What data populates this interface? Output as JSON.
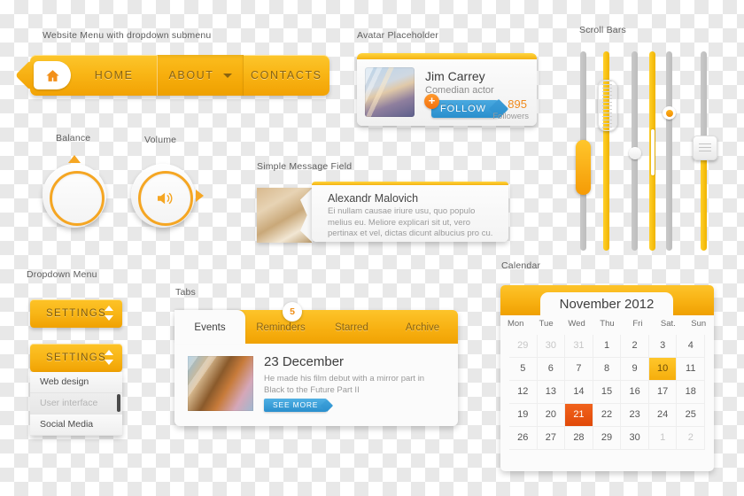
{
  "sections": {
    "menu_label": "Website Menu with dropdown submenu",
    "avatar_label": "Avatar Placeholder",
    "scrollbars_label": "Scroll Bars",
    "balance_label": "Balance",
    "volume_label": "Volume",
    "message_label": "Simple Message Field",
    "dropdown_label": "Dropdown Menu",
    "tabs_label": "Tabs",
    "calendar_label": "Calendar"
  },
  "menu": {
    "home_icon": "home-icon",
    "items": [
      {
        "label": "HOME",
        "active": false
      },
      {
        "label": "ABOUT",
        "active": true,
        "caret": "chevron-down-icon"
      },
      {
        "label": "CONTACTS",
        "active": false
      }
    ]
  },
  "avatar": {
    "name": "Jim Carrey",
    "role": "Comedian actor",
    "follow_label": "FOLLOW",
    "plus_icon": "+",
    "followers_count": "895",
    "followers_label": "Followers"
  },
  "knobs": {
    "balance": {
      "title": "Balance",
      "marker": "up"
    },
    "volume": {
      "title": "Volume",
      "marker": "right",
      "icon": "speaker-icon"
    }
  },
  "message": {
    "name": "Alexandr Malovich",
    "body": "Ei nullam causae iriure usu, quo populo melius eu. Meliore explicari sit ut, vero pertinax et vel, dictas dicunt albucius pro cu."
  },
  "dropdown": {
    "button_label": "SETTINGS",
    "open_button_label": "SETTINGS",
    "items": [
      {
        "label": "Web design",
        "disabled": false
      },
      {
        "label": "User interface",
        "disabled": true
      },
      {
        "label": "Social Media",
        "disabled": false
      }
    ]
  },
  "tabs": {
    "badge": "5",
    "items": [
      {
        "label": "Events",
        "active": true
      },
      {
        "label": "Reminders",
        "active": false
      },
      {
        "label": "Starred",
        "active": false
      },
      {
        "label": "Archive",
        "active": false
      }
    ],
    "event": {
      "title": "23 December",
      "description": "He made his film debut with a mirror part in Black to the Future Part II",
      "button_label": "SEE MORE"
    }
  },
  "calendar": {
    "title": "November 2012",
    "dow": [
      "Mon",
      "Tue",
      "Wed",
      "Thu",
      "Fri",
      "Sat.",
      "Sun"
    ],
    "weeks": [
      [
        {
          "d": "29",
          "s": "mute"
        },
        {
          "d": "30",
          "s": "mute"
        },
        {
          "d": "31",
          "s": "mute"
        },
        {
          "d": "1",
          "s": ""
        },
        {
          "d": "2",
          "s": ""
        },
        {
          "d": "3",
          "s": ""
        },
        {
          "d": "4",
          "s": ""
        }
      ],
      [
        {
          "d": "5",
          "s": ""
        },
        {
          "d": "6",
          "s": ""
        },
        {
          "d": "7",
          "s": ""
        },
        {
          "d": "8",
          "s": ""
        },
        {
          "d": "9",
          "s": ""
        },
        {
          "d": "10",
          "s": "sel-y"
        },
        {
          "d": "11",
          "s": ""
        }
      ],
      [
        {
          "d": "12",
          "s": ""
        },
        {
          "d": "13",
          "s": ""
        },
        {
          "d": "14",
          "s": ""
        },
        {
          "d": "15",
          "s": ""
        },
        {
          "d": "16",
          "s": ""
        },
        {
          "d": "17",
          "s": ""
        },
        {
          "d": "18",
          "s": ""
        }
      ],
      [
        {
          "d": "19",
          "s": ""
        },
        {
          "d": "20",
          "s": ""
        },
        {
          "d": "21",
          "s": "sel-o"
        },
        {
          "d": "22",
          "s": ""
        },
        {
          "d": "23",
          "s": ""
        },
        {
          "d": "24",
          "s": ""
        },
        {
          "d": "25",
          "s": ""
        }
      ],
      [
        {
          "d": "26",
          "s": ""
        },
        {
          "d": "27",
          "s": ""
        },
        {
          "d": "28",
          "s": ""
        },
        {
          "d": "29",
          "s": ""
        },
        {
          "d": "30",
          "s": ""
        },
        {
          "d": "1",
          "s": "mute"
        },
        {
          "d": "2",
          "s": "mute"
        }
      ]
    ]
  },
  "scrollbars": [
    {
      "track": "gray",
      "thumb": "orange-pill"
    },
    {
      "track": "yellow",
      "thumb": "white-ridged-pill"
    },
    {
      "track": "gray",
      "thumb": "white-dot"
    },
    {
      "track": "yellow",
      "thumb": "white-notch"
    },
    {
      "track": "gray",
      "thumb": "orange-dot"
    },
    {
      "track": "split",
      "thumb": "white-ridged-square"
    }
  ],
  "colors": {
    "amber": "#f7af10",
    "amber_dark": "#f0a203",
    "orange": "#f3700d",
    "red_orange": "#e14a09",
    "blue": "#2a8fcd",
    "text_dark": "#3d3d3d",
    "text_muted": "#9a9a9a"
  }
}
